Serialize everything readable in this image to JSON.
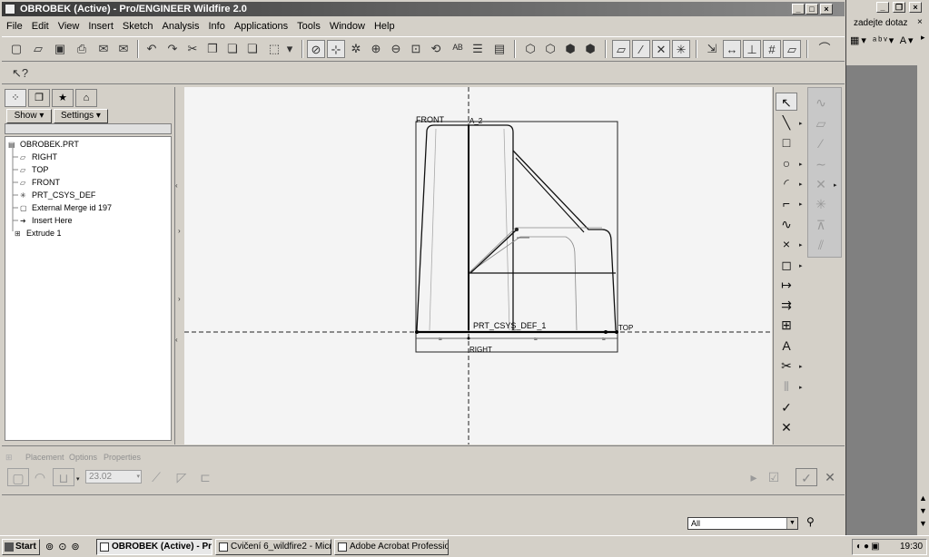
{
  "window": {
    "title": "OBROBEK (Active) - Pro/ENGINEER Wildfire 2.0",
    "min": "_",
    "max": "□",
    "close": "×"
  },
  "menu": [
    "File",
    "Edit",
    "View",
    "Insert",
    "Sketch",
    "Analysis",
    "Info",
    "Applications",
    "Tools",
    "Window",
    "Help"
  ],
  "nav": {
    "show_label": "Show",
    "settings_label": "Settings",
    "tree": [
      "OBROBEK.PRT",
      "RIGHT",
      "TOP",
      "FRONT",
      "PRT_CSYS_DEF",
      "External Merge id 197",
      "Insert Here",
      "Extrude 1"
    ]
  },
  "sketch": {
    "front_label": "FRONT",
    "a2_label": "A_2",
    "csys_label": "PRT_CSYS_DEF_1",
    "top_label": "TOP",
    "right_label": "RIGHT"
  },
  "dashboard": {
    "tabs": [
      "Placement",
      "Options",
      "Properties"
    ],
    "depth_value": "23.02"
  },
  "status": {
    "filter_value": "All"
  },
  "right_app": {
    "ask_text": "zadejte dotaz"
  },
  "taskbar": {
    "start_label": "Start",
    "tasks": [
      "OBROBEK (Active) - Pr...",
      "Cvičení 6_wildfire2 - Micr...",
      "Adobe Acrobat Professio..."
    ],
    "clock": "19:30"
  },
  "colors": {
    "title_gradient_start": "#3a3a3a",
    "canvas_bg": "#f4f4f4",
    "chrome": "#d4d0c8"
  }
}
